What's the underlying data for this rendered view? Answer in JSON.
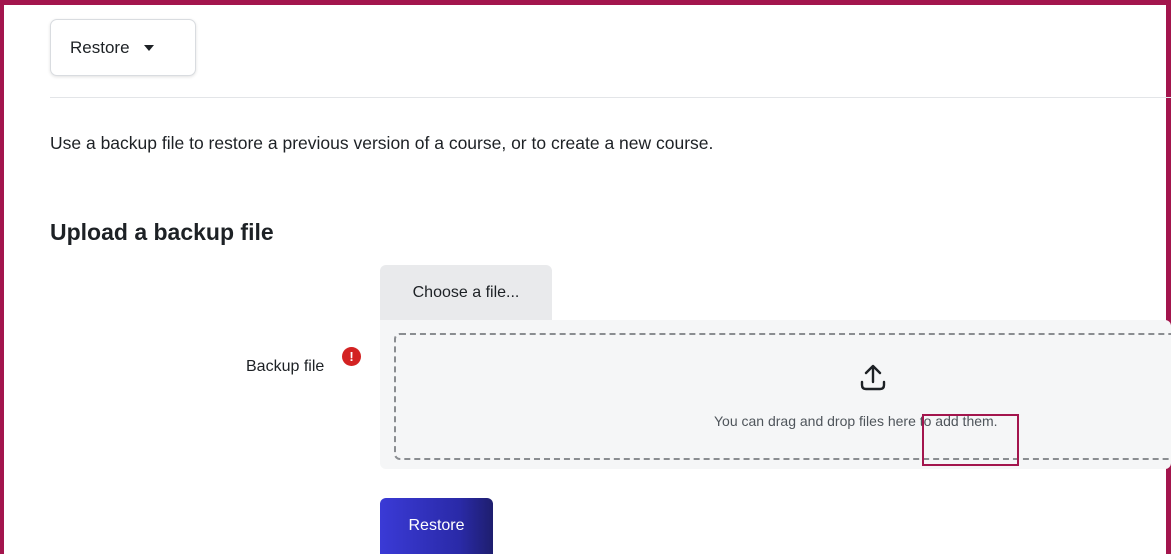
{
  "action_menu": {
    "label": "Restore",
    "caret_icon": "caret-down-icon"
  },
  "intro_text": "Use a backup file to restore a previous version of a course, or to create a new course.",
  "section": {
    "heading": "Upload a backup file"
  },
  "file_field": {
    "choose_button_label": "Choose a file...",
    "label": "Backup file",
    "required_icon": "exclamation-circle-icon",
    "required_color": "#d32222",
    "drop_icon": "upload-icon",
    "drop_text": "You can drag and drop files here to add them."
  },
  "submit": {
    "label": "Restore",
    "color": "#3a3ad6"
  },
  "accent_color": "#a3154d"
}
